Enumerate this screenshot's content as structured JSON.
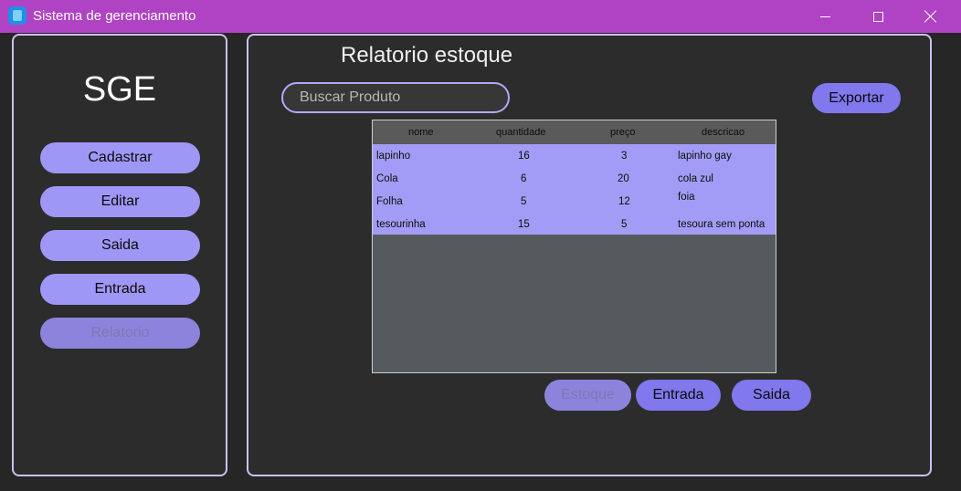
{
  "window": {
    "title": "Sistema de gerenciamento"
  },
  "sidebar": {
    "brand": "SGE",
    "items": [
      {
        "label": "Cadastrar",
        "enabled": true
      },
      {
        "label": "Editar",
        "enabled": true
      },
      {
        "label": "Saida",
        "enabled": true
      },
      {
        "label": "Entrada",
        "enabled": true
      },
      {
        "label": "Relatorio",
        "enabled": false
      }
    ]
  },
  "main": {
    "title": "Relatorio estoque",
    "search": {
      "placeholder": "Buscar Produto",
      "value": ""
    },
    "export_label": "Exportar",
    "table": {
      "columns": [
        "nome",
        "quantidade",
        "preço",
        "descricao"
      ],
      "rows": [
        {
          "nome": "lapinho",
          "quantidade": "16",
          "preco": "3",
          "descricao": "lapinho gay"
        },
        {
          "nome": "Cola",
          "quantidade": "6",
          "preco": "20",
          "descricao": "cola zul"
        },
        {
          "nome": "Folha",
          "quantidade": "5",
          "preco": "12",
          "descricao": "foia"
        },
        {
          "nome": "tesourinha",
          "quantidade": "15",
          "preco": "5",
          "descricao": "tesoura sem ponta"
        }
      ]
    },
    "tabs": [
      {
        "label": "Estoque",
        "enabled": false
      },
      {
        "label": "Entrada",
        "enabled": true
      },
      {
        "label": "Saida",
        "enabled": true
      }
    ]
  },
  "colors": {
    "titlebar": "#b042c4",
    "accent": "#9f97f5",
    "accent_dark": "#8078ec",
    "panel_border": "#c9c2ee"
  }
}
